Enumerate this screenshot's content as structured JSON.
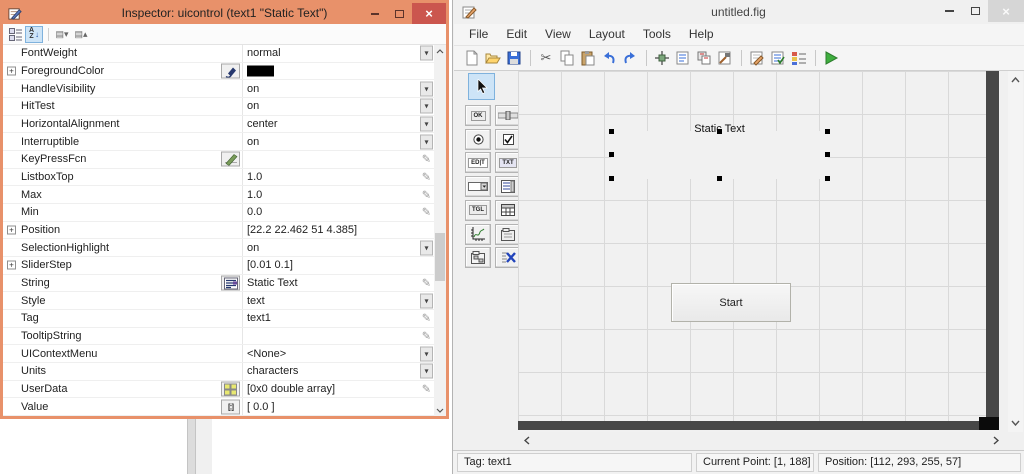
{
  "colors": {
    "accent_orange": "#e8916a",
    "close_red": "#cb564e",
    "selected_tool_blue": "#cde4f7",
    "run_green": "#3fae3f",
    "figure_edge_dark": "#474747",
    "foreground_swatch": "#000000"
  },
  "inspector": {
    "title": "Inspector:  uicontrol (text1 \"Static Text\")",
    "toolbar_icons": [
      {
        "name": "categorized-view",
        "selected": false
      },
      {
        "name": "alpha-sort",
        "selected": true
      },
      {
        "name": "expand-all",
        "selected": false
      },
      {
        "name": "collapse-all",
        "selected": false
      }
    ],
    "rows": [
      {
        "name": "FontWeight",
        "value": "normal",
        "control": "dropdown"
      },
      {
        "name": "ForegroundColor",
        "value": "",
        "control": "none",
        "expandable": true,
        "icon": "paint-icon",
        "swatch": "#000000"
      },
      {
        "name": "HandleVisibility",
        "value": "on",
        "control": "dropdown"
      },
      {
        "name": "HitTest",
        "value": "on",
        "control": "dropdown"
      },
      {
        "name": "HorizontalAlignment",
        "value": "center",
        "control": "dropdown"
      },
      {
        "name": "Interruptible",
        "value": "on",
        "control": "dropdown"
      },
      {
        "name": "KeyPressFcn",
        "value": "",
        "control": "pencil",
        "icon": "callback-editor-icon"
      },
      {
        "name": "ListboxTop",
        "value": "1.0",
        "control": "pencil"
      },
      {
        "name": "Max",
        "value": "1.0",
        "control": "pencil"
      },
      {
        "name": "Min",
        "value": "0.0",
        "control": "pencil"
      },
      {
        "name": "Position",
        "value": "[22.2 22.462 51 4.385]",
        "control": "none",
        "expandable": true
      },
      {
        "name": "SelectionHighlight",
        "value": "on",
        "control": "dropdown"
      },
      {
        "name": "SliderStep",
        "value": "[0.01 0.1]",
        "control": "none",
        "expandable": true
      },
      {
        "name": "String",
        "value": "Static Text",
        "control": "pencil",
        "icon": "string-editor-icon"
      },
      {
        "name": "Style",
        "value": "text",
        "control": "dropdown"
      },
      {
        "name": "Tag",
        "value": "text1",
        "control": "pencil"
      },
      {
        "name": "TooltipString",
        "value": "",
        "control": "pencil"
      },
      {
        "name": "UIContextMenu",
        "value": "<None>",
        "control": "dropdown"
      },
      {
        "name": "Units",
        "value": "characters",
        "control": "dropdown"
      },
      {
        "name": "UserData",
        "value": "[0x0  double array]",
        "control": "pencil",
        "icon": "array-editor-icon"
      },
      {
        "name": "Value",
        "value": "[ 0.0 ]",
        "control": "none",
        "icon": "value-array-icon"
      }
    ]
  },
  "figure": {
    "title": "untitled.fig",
    "menus": [
      "File",
      "Edit",
      "View",
      "Layout",
      "Tools",
      "Help"
    ],
    "toolbar_groups": [
      [
        "new",
        "open",
        "save"
      ],
      [
        "cut",
        "copy",
        "paste",
        "undo",
        "redo"
      ],
      [
        "align-objects",
        "menu-editor",
        "tab-order-editor",
        "toolbar-editor"
      ],
      [
        "mfile-editor",
        "property-inspector",
        "object-browser"
      ],
      [
        "run"
      ]
    ],
    "palette_tools": [
      "select",
      "push-button",
      "slider",
      "radio-button",
      "check-box",
      "edit-text",
      "static-text",
      "popup-menu",
      "listbox",
      "toggle-button",
      "table",
      "axes",
      "panel",
      "button-group",
      "activex-control"
    ],
    "canvas": {
      "static_text_label": "Static Text",
      "start_button_label": "Start"
    },
    "status": {
      "tag": "Tag: text1",
      "current_point": "Current Point:  [1, 188]",
      "position": "Position: [112, 293, 255, 57]"
    }
  }
}
